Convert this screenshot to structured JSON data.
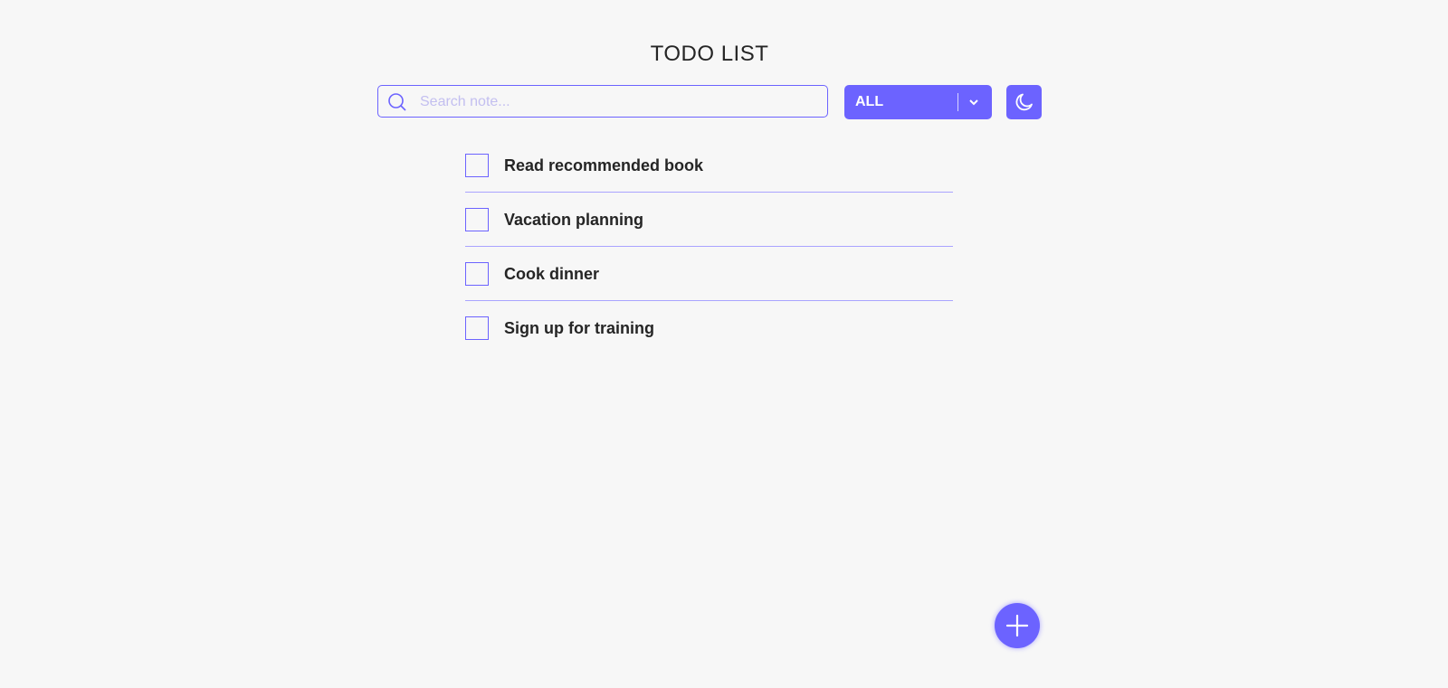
{
  "header": {
    "title": "TODO LIST"
  },
  "search": {
    "placeholder": "Search note...",
    "value": ""
  },
  "filter": {
    "selected": "ALL"
  },
  "todos": [
    {
      "label": "Read recommended book",
      "checked": false
    },
    {
      "label": "Vacation planning",
      "checked": false
    },
    {
      "label": "Cook dinner",
      "checked": false
    },
    {
      "label": "Sign up for training",
      "checked": false
    }
  ],
  "colors": {
    "accent": "#6c63ff",
    "background": "#f7f7f7"
  }
}
